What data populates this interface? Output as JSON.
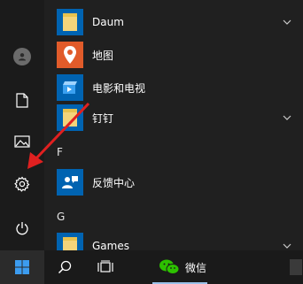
{
  "apps": [
    {
      "label": "Daum",
      "icon": "folder-icon",
      "expandable": true
    },
    {
      "label": "地图",
      "icon": "map-pin-icon",
      "expandable": false
    },
    {
      "label": "电影和电视",
      "icon": "film-icon",
      "expandable": false
    },
    {
      "label": "钉钉",
      "icon": "folder-icon",
      "expandable": true
    },
    {
      "label": "反馈中心",
      "icon": "feedback-icon",
      "expandable": false
    },
    {
      "label": "Games",
      "icon": "folder-icon",
      "expandable": true
    }
  ],
  "letters": {
    "f": "F",
    "g": "G"
  },
  "rail": {
    "icons": [
      "user-avatar-icon",
      "document-icon",
      "pictures-icon",
      "settings-gear-icon",
      "power-icon"
    ]
  },
  "taskbar": {
    "wechat_label": "微信",
    "icons": [
      "windows-start-icon",
      "search-icon",
      "task-view-icon",
      "wechat-icon"
    ]
  },
  "colors": {
    "accent_arrow": "#e02020",
    "tile_blue": "#0063b1",
    "folder_yellow": "#f4d47a"
  }
}
